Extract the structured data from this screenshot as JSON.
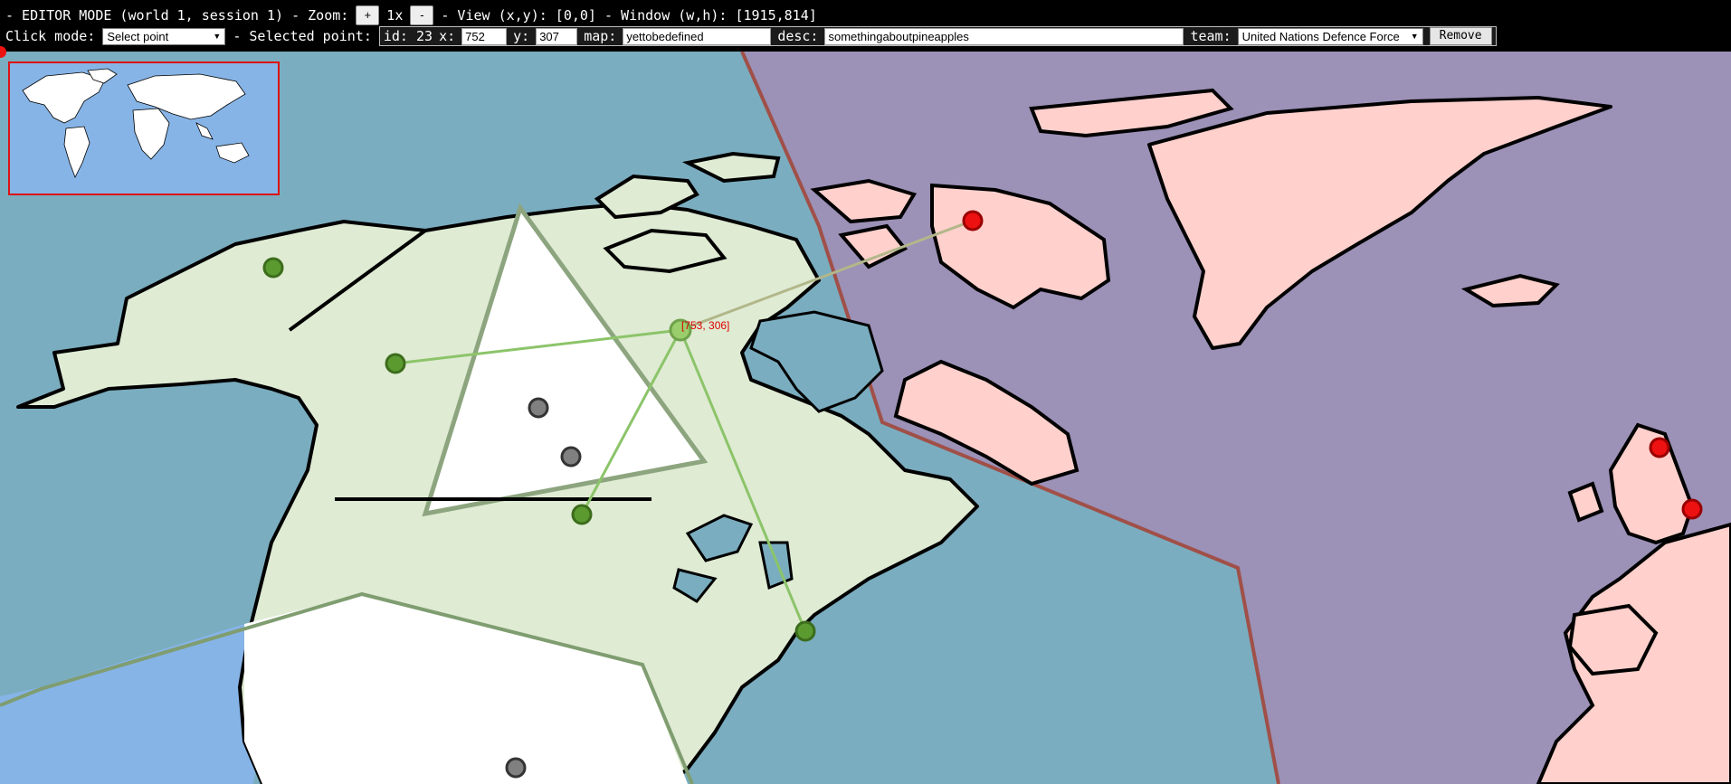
{
  "toolbar": {
    "mode_prefix": "- EDITOR MODE (world 1, session 1) - Zoom:",
    "zoom_in": "+",
    "zoom_level": "1x",
    "zoom_out": "-",
    "view_text": "- View (x,y): [0,0] - Window (w,h): [1915,814]",
    "click_mode_label": "Click mode:",
    "click_mode_value": "Select point",
    "selected_point_label": "- Selected point:"
  },
  "selected_point": {
    "id_label": "id: 23",
    "x_label": "x:",
    "x_value": "752",
    "y_label": "y:",
    "y_value": "307",
    "map_label": "map:",
    "map_value": "yettobedefined",
    "desc_label": "desc:",
    "desc_value": "somethingaboutpineapples",
    "team_label": "team:",
    "team_value": "United Nations Defence Force",
    "remove_label": "Remove"
  },
  "map": {
    "hover_coord": "[753, 306]",
    "colors": {
      "ocean": "#7aadbf",
      "deep_ocean": "#87b4e6",
      "enemy_zone": "#9c91b7",
      "friendly_land": "#dfebd3",
      "enemy_land": "#ffd0cc",
      "friendly_point": "#5a9a2f",
      "enemy_point": "#ee1111",
      "neutral_point": "#808080"
    },
    "icons": [
      "friendly-point-icon",
      "enemy-point-icon",
      "neutral-point-icon"
    ]
  }
}
